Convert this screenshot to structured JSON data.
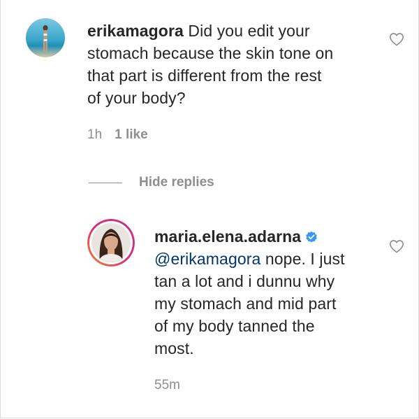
{
  "comment": {
    "username": "erikamagora",
    "text": "Did you edit your stomach because the skin tone on that part is different from the rest of your body?",
    "line1_text": "Did you edit your",
    "line2": "stomach because the skin tone on",
    "line3": "that part is different from the rest",
    "line4": "of your body?",
    "time": "1h",
    "likes": "1 like",
    "like_icon": "heart-outline-icon"
  },
  "hide_replies_label": "Hide replies",
  "reply": {
    "username": "maria.elena.adarna",
    "verified": true,
    "mention": "@erikamagora",
    "line1_rest": "nope. I just",
    "line2": "tan a lot and i dunnu why",
    "line3": "my stomach and mid part",
    "line4": "of my body tanned the",
    "line5": "most.",
    "time": "55m",
    "like_icon": "heart-outline-icon"
  },
  "colors": {
    "text": "#262626",
    "secondary": "#8e8e8e",
    "mention": "#00376b",
    "verified": "#3897f0",
    "story_ring_start": "#f58529",
    "story_ring_end": "#c13584"
  }
}
